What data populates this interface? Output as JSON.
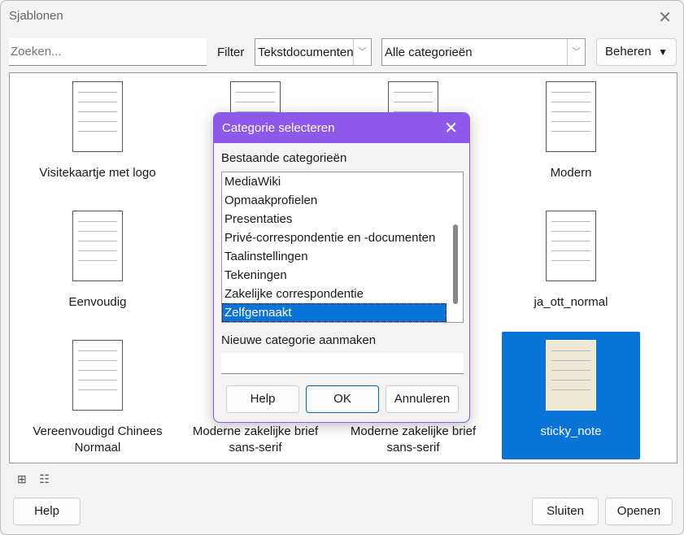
{
  "window": {
    "title": "Sjablonen"
  },
  "toolbar": {
    "search_placeholder": "Zoeken...",
    "filter_label": "Filter",
    "doc_type": "Tekstdocumenten",
    "category": "Alle categorieën",
    "manage_label": "Beheren"
  },
  "templates": [
    {
      "label": "Visitekaartje met logo"
    },
    {
      "label": ""
    },
    {
      "label": ""
    },
    {
      "label": "Modern"
    },
    {
      "label": "Eenvoudig"
    },
    {
      "label": ""
    },
    {
      "label": ""
    },
    {
      "label": "ja_ott_normal"
    },
    {
      "label": "Vereenvoudigd Chinees Normaal"
    },
    {
      "label": "Moderne zakelijke brief sans-serif"
    },
    {
      "label": "Moderne zakelijke brief sans-serif"
    },
    {
      "label": "sticky_note",
      "selected": true
    }
  ],
  "footer": {
    "help": "Help",
    "close": "Sluiten",
    "open": "Openen"
  },
  "dialog": {
    "title": "Categorie selecteren",
    "existing_label": "Bestaande categorieën",
    "categories": [
      "MediaWiki",
      "Opmaakprofielen",
      "Presentaties",
      "Privé-correspondentie en -documenten",
      "Taalinstellingen",
      "Tekeningen",
      "Zakelijke correspondentie",
      "Zelfgemaakt"
    ],
    "selected": "Zelfgemaakt",
    "new_label": "Nieuwe categorie aanmaken",
    "new_value": "",
    "help": "Help",
    "ok": "OK",
    "cancel": "Annuleren"
  },
  "colors": {
    "accent": "#0a74d6",
    "dialog_title": "#8e59e8"
  }
}
